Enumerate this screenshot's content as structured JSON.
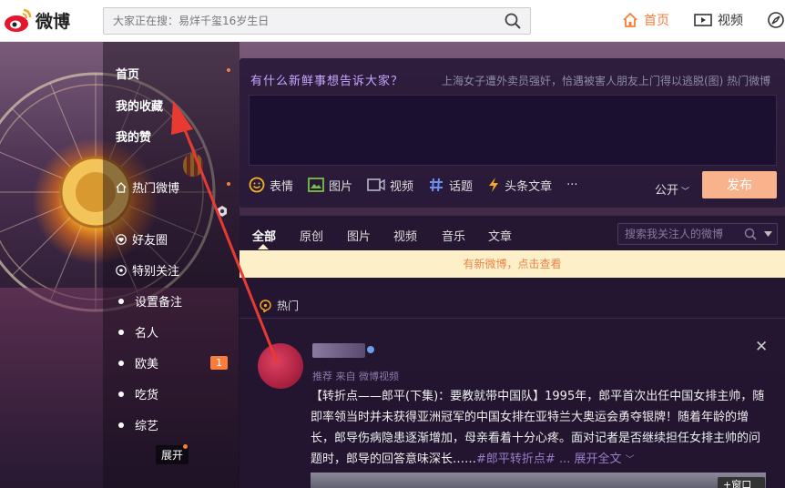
{
  "brand": {
    "name": "微博",
    "color": "#e6162d"
  },
  "search": {
    "placeholder": "大家正在搜：易烊千玺16岁生日"
  },
  "nav": {
    "home": "首页",
    "video": "视频"
  },
  "leftnav": {
    "items": [
      "首页",
      "我的收藏",
      "我的赞"
    ],
    "hot": "热门微博",
    "friends": "好友圈",
    "special": "特别关注",
    "groups": [
      "设置备注",
      "名人",
      "欧美",
      "吃货",
      "综艺"
    ],
    "badge": "1",
    "expand": "展开"
  },
  "composer": {
    "prompt": "有什么新鲜事想告诉大家？",
    "hot_topic": "上海女子遭外卖员强奸，恰遇被害人朋友上门得以逃脱(图)   热门微博",
    "tools": [
      "表情",
      "图片",
      "视频",
      "话题",
      "头条文章"
    ],
    "more": "···",
    "visibility": "公开",
    "submit": "发布"
  },
  "feed": {
    "tabs": [
      "全部",
      "原创",
      "图片",
      "视频",
      "音乐",
      "文章"
    ],
    "search_placeholder": "搜索我关注人的微博",
    "new_notice": "有新微博，点击查看",
    "hot_label": "热门",
    "post": {
      "source": "推荐 来自 微博视频",
      "text": "【转折点——郎平(下集)：要教就带中国队】1995年，郎平首次出任中国女排主帅，随即率领当时并未获得亚洲冠军的中国女排在亚特兰大奥运会勇夺银牌！随着年龄的增长，郎导伤病隐患逐渐增加，母亲看着十分心疼。面对记者是否继续担任女排主帅的问题时，郎导的回答意味深长……",
      "tag": "#郎平转折点#",
      "expand": "... 展开全文",
      "media_tag": "+窗口"
    }
  },
  "colors": {
    "accent": "#fa7d3c",
    "arrow": "#e83a32"
  }
}
